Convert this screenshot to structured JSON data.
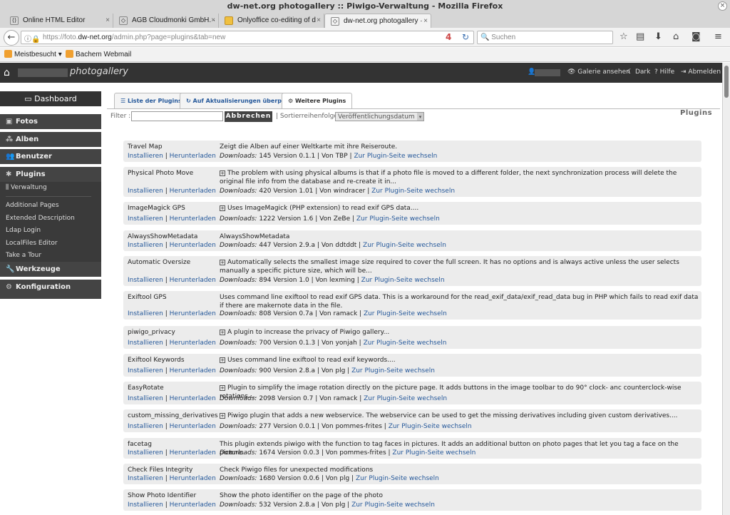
{
  "window": {
    "title": "dw-net.org photogallery :: Piwigo-Verwaltung - Mozilla Firefox",
    "close": "×"
  },
  "tabs": [
    {
      "label": "Online HTML Editor",
      "icon": "html-icon"
    },
    {
      "label": "AGB Cloudmonki GmbH. ·",
      "icon": "shield-icon"
    },
    {
      "label": "Onlyoffice co-editing of d",
      "icon": "folder-icon"
    },
    {
      "label": "dw-net.org photogallery ·",
      "icon": "shield-icon",
      "active": true
    }
  ],
  "nav": {
    "url_prefix": "https://foto.",
    "url_domain": "dw-net.org",
    "url_path": "/admin.php?page=plugins&tab=new",
    "url_badge": "4",
    "search_placeholder": "Suchen"
  },
  "bookmarks": [
    {
      "label": "Meistbesucht ▾"
    },
    {
      "label": "Bachem Webmail"
    }
  ],
  "header": {
    "site_title": "photogallery",
    "gallery_link": "Galerie ansehen",
    "theme_link": "Dark",
    "help_link": "Hilfe",
    "logout_link": "Abmelden"
  },
  "sidebar": {
    "dashboard": "Dashboard",
    "sections": [
      {
        "label": "Fotos",
        "icon": "photo-icon"
      },
      {
        "label": "Alben",
        "icon": "album-icon"
      },
      {
        "label": "Benutzer",
        "icon": "users-icon"
      },
      {
        "label": "Plugins",
        "icon": "puzzle-icon"
      },
      {
        "label": "Werkzeuge",
        "icon": "wrench-icon"
      },
      {
        "label": "Konfiguration",
        "icon": "gear-icon"
      }
    ],
    "plugin_sub": {
      "verwaltung": "Verwaltung",
      "items": [
        "Additional Pages",
        "Extended Description",
        "Ldap Login",
        "LocalFiles Editor",
        "Take a Tour"
      ]
    }
  },
  "page": {
    "tabs": [
      "Liste der Plugins",
      "Auf Aktualisierungen überprüfen",
      "Weitere Plugins"
    ],
    "filter_label": "Filter :",
    "reset_button": "Abbrechen",
    "sort_label": "| Sortierreihenfolge :",
    "sort_value": "Veröffentlichungsdatum",
    "title": "Plugins",
    "install": "Installieren",
    "download": "Herunterladen",
    "downloads_label": "Downloads:",
    "plugin_page": "Zur Plugin-Seite wechseln"
  },
  "plugins": [
    {
      "name": "Travel Map",
      "desc": "Zeigt die Alben auf einer Weltkarte mit ihre Reiseroute.",
      "expand": false,
      "downloads": "145",
      "version": "Version 0.1.1",
      "author": "| Von TBP |"
    },
    {
      "name": "Physical Photo Move",
      "desc": "The problem with using physical albums is that if a photo file is moved to a different folder, the next synchronization process will delete the original file info from the database and re-create it in...",
      "expand": true,
      "downloads": "420",
      "version": "Version 1.01",
      "author": "| Von windracer |"
    },
    {
      "name": "ImageMagick GPS",
      "desc": "Uses ImageMagick (PHP extension) to read exif GPS data....",
      "expand": true,
      "downloads": "1222",
      "version": "Version 1.6",
      "author": "| Von ZeBe |"
    },
    {
      "name": "AlwaysShowMetadata",
      "desc": "AlwaysShowMetadata",
      "expand": false,
      "downloads": "447",
      "version": "Version 2.9.a",
      "author": "| Von ddtddt |"
    },
    {
      "name": "Automatic Oversize",
      "desc": "Automatically selects the smallest image size required to cover the full screen. It has no options and is always active unless the user selects manually a specific picture size, which will be...",
      "expand": true,
      "downloads": "894",
      "version": "Version 1.0",
      "author": "| Von lexming |"
    },
    {
      "name": "Exiftool GPS",
      "desc": "Uses command line exiftool to read exif GPS data. This is a workaround for the read_exif_data/exif_read_data bug in PHP which fails to read exif data if there are makernote data in the file.",
      "expand": false,
      "downloads": "808",
      "version": "Version 0.7a",
      "author": "| Von ramack |"
    },
    {
      "name": "piwigo_privacy",
      "desc": "A plugin to increase the privacy of Piwigo gallery...",
      "expand": true,
      "downloads": "700",
      "version": "Version 0.1.3",
      "author": "| Von yonjah |"
    },
    {
      "name": "Exiftool Keywords",
      "desc": "Uses command line exiftool to read exif keywords....",
      "expand": true,
      "downloads": "900",
      "version": "Version 2.8.a",
      "author": "| Von plg |"
    },
    {
      "name": "EasyRotate",
      "desc": "Plugin to simplify the image rotation directly on the picture page. It adds buttons in the image toolbar to do 90° clock- anc counterclock-wise rotations....",
      "expand": true,
      "downloads": "2098",
      "version": "Version 0.7",
      "author": "| Von ramack |"
    },
    {
      "name": "custom_missing_derivatives",
      "desc": "Piwigo plugin that adds a new webservice. The webservice can be used to get the missing derivatives including given custom derivatives....",
      "expand": true,
      "downloads": "277",
      "version": "Version 0.0.1",
      "author": "| Von pommes-frites |"
    },
    {
      "name": "facetag",
      "desc": "This plugin extends piwigo with the function to tag faces in pictures. It adds an additional button on photo pages that let you tag a face on the picture.",
      "expand": false,
      "downloads": "1674",
      "version": "Version 0.0.3",
      "author": "| Von pommes-frites |"
    },
    {
      "name": "Check Files Integrity",
      "desc": "Check Piwigo files for unexpected modifications",
      "expand": false,
      "downloads": "1680",
      "version": "Version 0.0.6",
      "author": "| Von plg |"
    },
    {
      "name": "Show Photo Identifier",
      "desc": "Show the photo identifier on the page of the photo",
      "expand": false,
      "downloads": "532",
      "version": "Version 2.8.a",
      "author": "| Von plg |"
    }
  ]
}
